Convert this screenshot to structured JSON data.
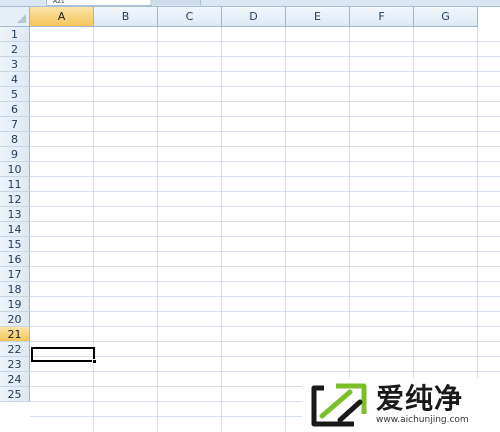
{
  "toolbar": {
    "namebox_value": "A21"
  },
  "columns": [
    "A",
    "B",
    "C",
    "D",
    "E",
    "F",
    "G"
  ],
  "rows": [
    "1",
    "2",
    "3",
    "4",
    "5",
    "6",
    "7",
    "8",
    "9",
    "10",
    "11",
    "12",
    "13",
    "14",
    "15",
    "16",
    "17",
    "18",
    "19",
    "20",
    "21",
    "22",
    "23",
    "24",
    "25"
  ],
  "selection": {
    "active_column": "A",
    "active_row": "21"
  },
  "watermark": {
    "name": "爱纯净",
    "url": "www.aichunjing.com"
  },
  "colors": {
    "accent": "#f5c65a",
    "gridline": "#d5e0ec",
    "header_bg": "#dde8f5",
    "logo_green": "#7cbf2a"
  },
  "icons": {
    "select_all": "select-all-triangle-icon",
    "logo": "aichunjing-logo-icon"
  }
}
